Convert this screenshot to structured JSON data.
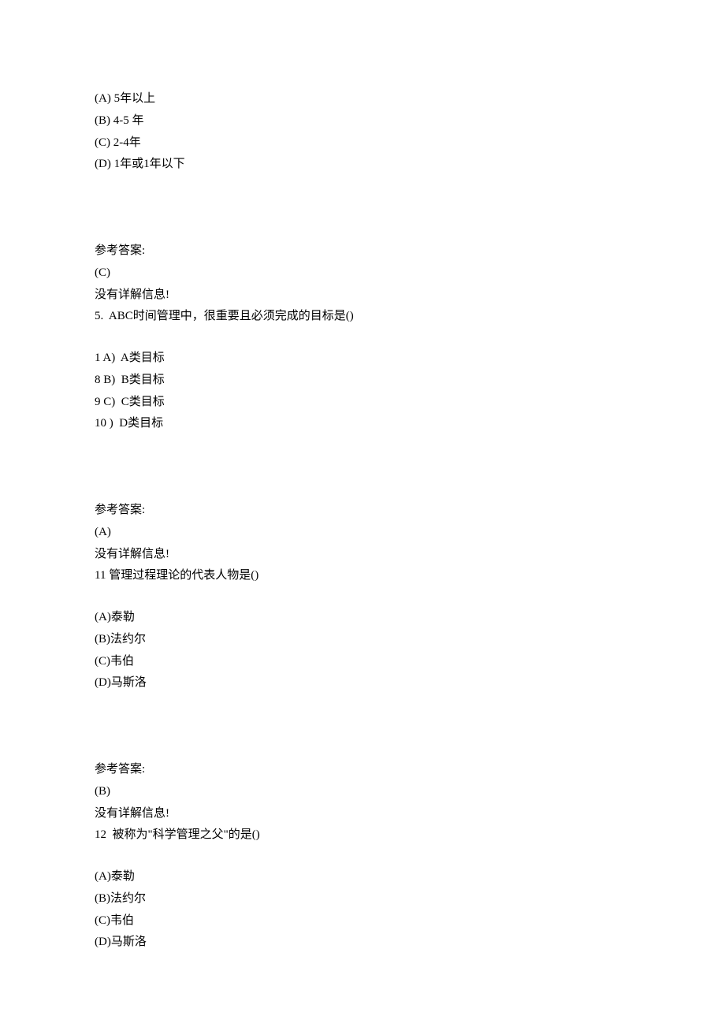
{
  "q4": {
    "options": [
      "(A) 5年以上",
      "(B) 4-5 年",
      "(C) 2-4年",
      "(D) 1年或1年以下"
    ],
    "answer_label": "参考答案:",
    "answer": "(C)",
    "note": "没有详解信息!"
  },
  "q5": {
    "stem": "5.  ABC时间管理中，很重要且必须完成的目标是()",
    "options": [
      "1 A)  A类目标",
      "8 B)  B类目标",
      "9 C)  C类目标",
      "10 )  D类目标"
    ],
    "answer_label": "参考答案:",
    "answer": "(A)",
    "note": "没有详解信息!"
  },
  "q11": {
    "stem": "11 管理过程理论的代表人物是()",
    "options": [
      "(A)泰勒",
      "(B)法约尔",
      "(C)韦伯",
      "(D)马斯洛"
    ],
    "answer_label": "参考答案:",
    "answer": "(B)",
    "note": "没有详解信息!"
  },
  "q12": {
    "stem": "12  被称为\"科学管理之父\"的是()",
    "options": [
      "(A)泰勒",
      "(B)法约尔",
      "(C)韦伯",
      "(D)马斯洛"
    ]
  }
}
